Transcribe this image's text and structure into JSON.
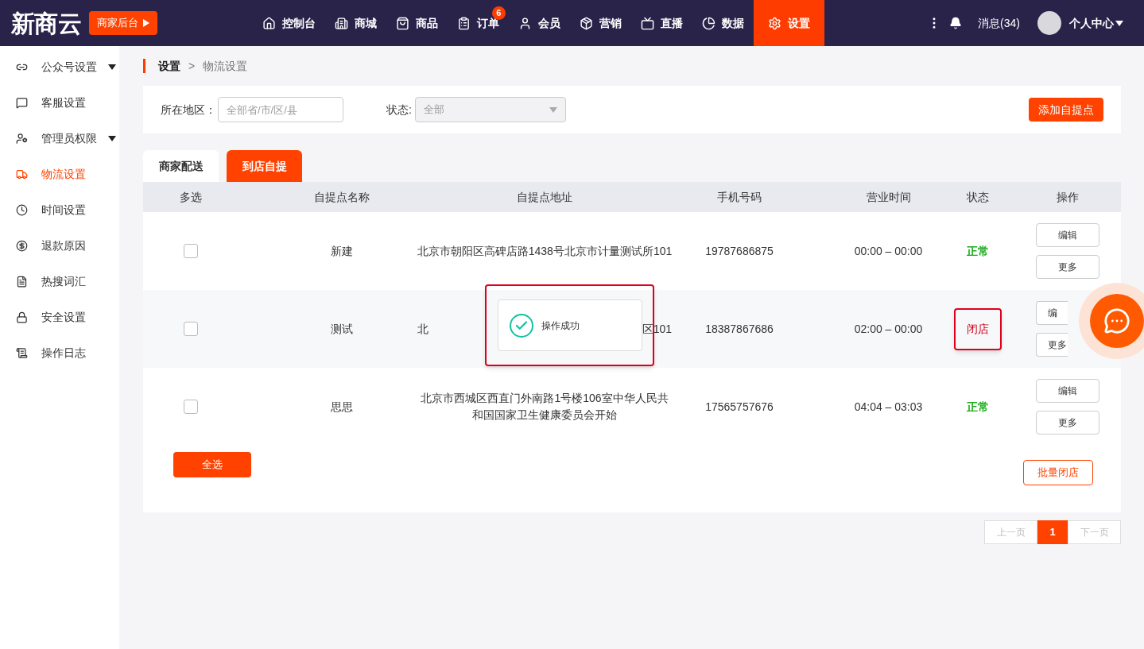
{
  "brand": {
    "logo": "新商云",
    "backstage_button": "商家后台"
  },
  "nav": [
    {
      "label": "控制台",
      "selected": false
    },
    {
      "label": "商城",
      "selected": false
    },
    {
      "label": "商品",
      "selected": false
    },
    {
      "label": "订单",
      "selected": false,
      "badge": "6"
    },
    {
      "label": "会员",
      "selected": false
    },
    {
      "label": "营销",
      "selected": false
    },
    {
      "label": "直播",
      "selected": false
    },
    {
      "label": "数据",
      "selected": false
    },
    {
      "label": "设置",
      "selected": true
    }
  ],
  "header_right": {
    "messages": "消息(34)",
    "user": "个人中心"
  },
  "sidebar": {
    "items": [
      {
        "label": "公众号设置",
        "selected": false,
        "expandable": true
      },
      {
        "label": "客服设置",
        "selected": false,
        "expandable": false
      },
      {
        "label": "管理员权限",
        "selected": false,
        "expandable": true
      },
      {
        "label": "物流设置",
        "selected": true,
        "expandable": false
      },
      {
        "label": "时间设置",
        "selected": false,
        "expandable": false
      },
      {
        "label": "退款原因",
        "selected": false,
        "expandable": false
      },
      {
        "label": "热搜词汇",
        "selected": false,
        "expandable": false
      },
      {
        "label": "安全设置",
        "selected": false,
        "expandable": false
      },
      {
        "label": "操作日志",
        "selected": false,
        "expandable": false
      }
    ]
  },
  "breadcrumb": [
    "设置",
    ">",
    "物流设置"
  ],
  "filters": {
    "region_label": "所在地区：",
    "region_placeholder": "全部省/市/区/县",
    "status_label": "状态:",
    "status_value": "全部",
    "add_button": "添加自提点"
  },
  "tabs": [
    {
      "label": "商家配送",
      "selected": false
    },
    {
      "label": "到店自提",
      "selected": true
    }
  ],
  "table": {
    "columns": [
      "多选",
      "自提点名称",
      "自提点地址",
      "手机号码",
      "营业时间",
      "状态",
      "操作"
    ],
    "rows": [
      {
        "checked": false,
        "name": "新建",
        "address": [
          "北京市朝阳区高碑店路1438号北京市计量测试所101"
        ],
        "phone": "19787686875",
        "hours": "00:00 – 00:00",
        "status": "正常",
        "color": "#1aad19",
        "actions": [
          "编辑",
          "更多"
        ],
        "highlighted": false
      },
      {
        "checked": false,
        "name": "测试",
        "address_fragments": [
          "北",
          "区101"
        ],
        "phone": "18387867686",
        "hours": "02:00 – 00:00",
        "status": "闭店",
        "color": "#d0021b",
        "actions": [
          "编",
          "更多"
        ],
        "highlighted": true
      },
      {
        "checked": false,
        "name": "思思",
        "address": [
          "北京市西城区西直门外南路1号楼106室中华人民共",
          "和国国家卫生健康委员会开始"
        ],
        "phone": "17565757676",
        "hours": "04:04 – 03:03",
        "status": "正常",
        "color": "#1aad19",
        "actions": [
          "编辑",
          "更多"
        ],
        "highlighted": false
      }
    ]
  },
  "select_all_button": "全选",
  "batch_close_button": "批量闭店",
  "pagination": {
    "prev": "上一页",
    "pages": [
      {
        "label": "1",
        "selected": true
      }
    ],
    "next": "下一页"
  },
  "toast": {
    "message": "操作成功",
    "highlighted": true
  }
}
